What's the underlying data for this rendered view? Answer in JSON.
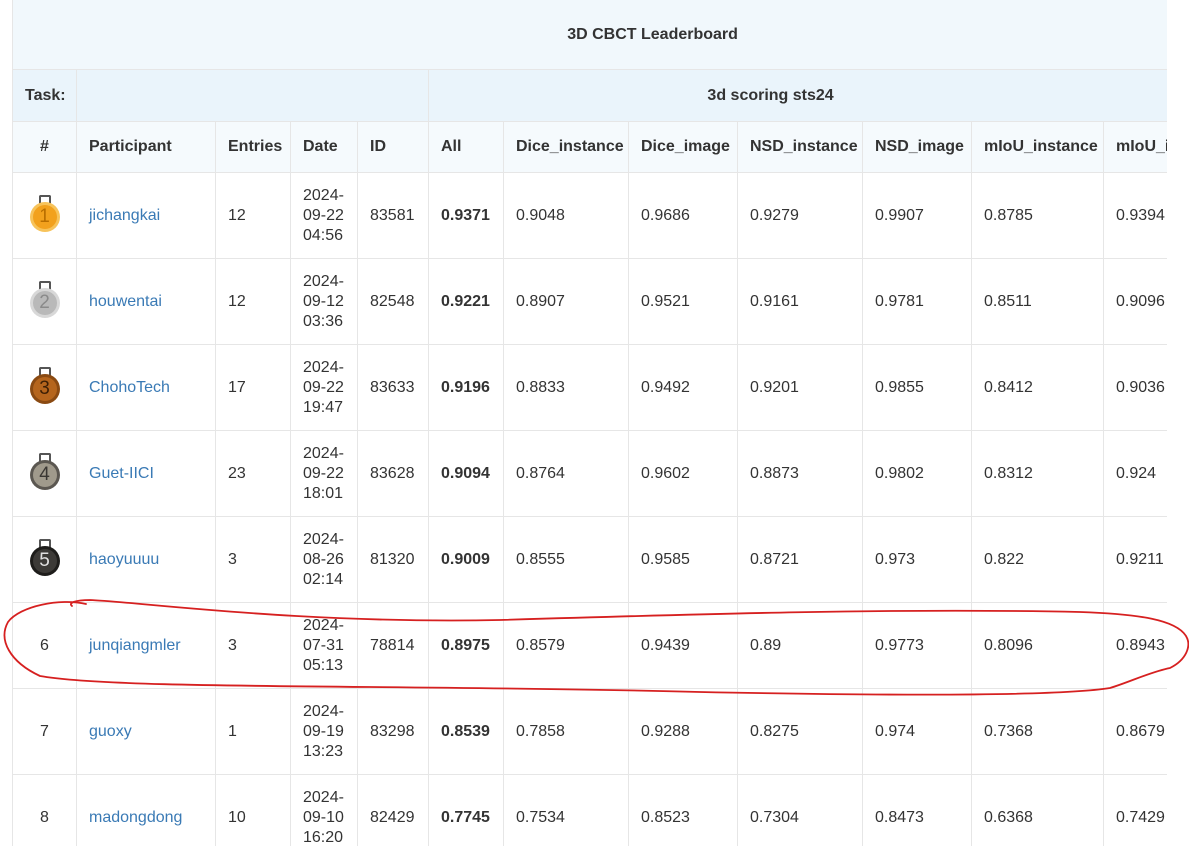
{
  "title": "3D CBCT Leaderboard",
  "task_label": "Task:",
  "task_name": "3d scoring sts24",
  "columns": [
    "#",
    "Participant",
    "Entries",
    "Date",
    "ID",
    "All",
    "Dice_instance",
    "Dice_image",
    "NSD_instance",
    "NSD_image",
    "mIoU_instance",
    "mIoU_i"
  ],
  "rows": [
    {
      "rank": "1",
      "participant": "jichangkai",
      "entries": "12",
      "date": "2024-09-22 04:56",
      "id": "83581",
      "all": "0.9371",
      "dice_instance": "0.9048",
      "dice_image": "0.9686",
      "nsd_instance": "0.9279",
      "nsd_image": "0.9907",
      "miou_instance": "0.8785",
      "miou_image": "0.9394"
    },
    {
      "rank": "2",
      "participant": "houwentai",
      "entries": "12",
      "date": "2024-09-12 03:36",
      "id": "82548",
      "all": "0.9221",
      "dice_instance": "0.8907",
      "dice_image": "0.9521",
      "nsd_instance": "0.9161",
      "nsd_image": "0.9781",
      "miou_instance": "0.8511",
      "miou_image": "0.9096"
    },
    {
      "rank": "3",
      "participant": "ChohoTech",
      "entries": "17",
      "date": "2024-09-22 19:47",
      "id": "83633",
      "all": "0.9196",
      "dice_instance": "0.8833",
      "dice_image": "0.9492",
      "nsd_instance": "0.9201",
      "nsd_image": "0.9855",
      "miou_instance": "0.8412",
      "miou_image": "0.9036"
    },
    {
      "rank": "4",
      "participant": "Guet-IICI",
      "entries": "23",
      "date": "2024-09-22 18:01",
      "id": "83628",
      "all": "0.9094",
      "dice_instance": "0.8764",
      "dice_image": "0.9602",
      "nsd_instance": "0.8873",
      "nsd_image": "0.9802",
      "miou_instance": "0.8312",
      "miou_image": "0.924"
    },
    {
      "rank": "5",
      "participant": "haoyuuuu",
      "entries": "3",
      "date": "2024-08-26 02:14",
      "id": "81320",
      "all": "0.9009",
      "dice_instance": "0.8555",
      "dice_image": "0.9585",
      "nsd_instance": "0.8721",
      "nsd_image": "0.973",
      "miou_instance": "0.822",
      "miou_image": "0.9211"
    },
    {
      "rank": "6",
      "participant": "junqiangmler",
      "entries": "3",
      "date": "2024-07-31 05:13",
      "id": "78814",
      "all": "0.8975",
      "dice_instance": "0.8579",
      "dice_image": "0.9439",
      "nsd_instance": "0.89",
      "nsd_image": "0.9773",
      "miou_instance": "0.8096",
      "miou_image": "0.8943"
    },
    {
      "rank": "7",
      "participant": "guoxy",
      "entries": "1",
      "date": "2024-09-19 13:23",
      "id": "83298",
      "all": "0.8539",
      "dice_instance": "0.7858",
      "dice_image": "0.9288",
      "nsd_instance": "0.8275",
      "nsd_image": "0.974",
      "miou_instance": "0.7368",
      "miou_image": "0.8679"
    },
    {
      "rank": "8",
      "participant": "madongdong",
      "entries": "10",
      "date": "2024-09-10 16:20",
      "id": "82429",
      "all": "0.7745",
      "dice_instance": "0.7534",
      "dice_image": "0.8523",
      "nsd_instance": "0.7304",
      "nsd_image": "0.8473",
      "miou_instance": "0.6368",
      "miou_image": "0.7429"
    }
  ],
  "medals": [
    {
      "rank": "1",
      "icon": "gold-medal-icon",
      "color": "#f2a11d",
      "ring": "#f7c35a",
      "text_color": "#b86e00"
    },
    {
      "rank": "2",
      "icon": "silver-medal-icon",
      "color": "#b9b9b9",
      "ring": "#d8d8d8",
      "text_color": "#8a8a8a"
    },
    {
      "rank": "3",
      "icon": "bronze-medal-icon",
      "color": "#b5651d",
      "ring": "#8a4a12",
      "text_color": "#3d1f05"
    },
    {
      "rank": "4",
      "icon": "fourth-place-medal-icon",
      "color": "#a09a8c",
      "ring": "#5b5751",
      "text_color": "#3a3733"
    },
    {
      "rank": "5",
      "icon": "fifth-place-medal-icon",
      "color": "#3c3a37",
      "ring": "#1e1d1b",
      "text_color": "#e0e0e0"
    }
  ],
  "colors": {
    "link": "#3a7ab5",
    "header_bg": "#f1f8fc",
    "annotation": "#d62020"
  },
  "annotation": {
    "highlighted_rank": "6",
    "shape": "hand-drawn-circle"
  }
}
